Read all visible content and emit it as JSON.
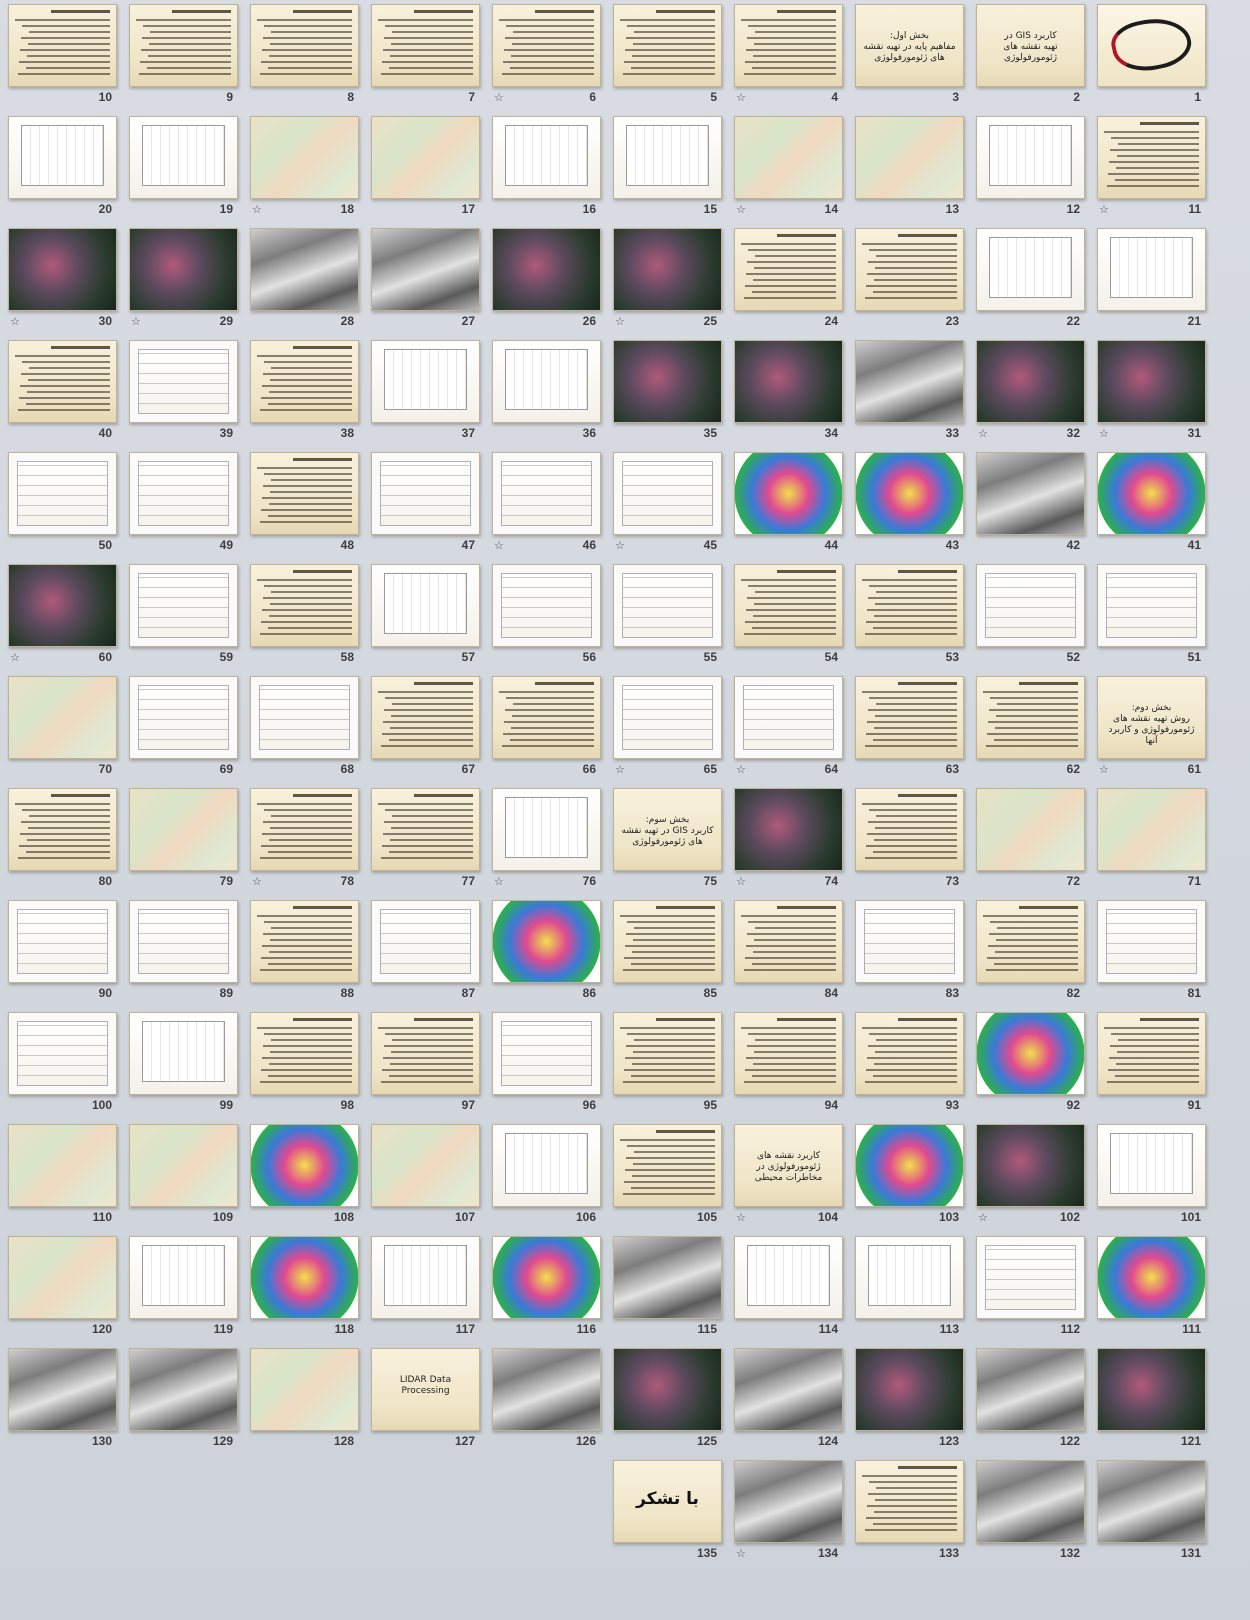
{
  "slides": [
    {
      "n": "1",
      "kind": "logo",
      "star": false
    },
    {
      "n": "2",
      "kind": "title",
      "text": "کاربرد GIS در\nتهیه نقشه های ژئومورفولوژی",
      "star": false
    },
    {
      "n": "3",
      "kind": "title",
      "text": "بخش اول:\nمفاهیم پایه در تهیه نقشه های ژئومورفولوژی",
      "star": false
    },
    {
      "n": "4",
      "kind": "text",
      "star": true
    },
    {
      "n": "5",
      "kind": "text",
      "star": false
    },
    {
      "n": "6",
      "kind": "text",
      "star": true
    },
    {
      "n": "7",
      "kind": "text",
      "star": false
    },
    {
      "n": "8",
      "kind": "text",
      "star": false
    },
    {
      "n": "9",
      "kind": "text",
      "star": false
    },
    {
      "n": "10",
      "kind": "text",
      "star": false
    },
    {
      "n": "11",
      "kind": "text",
      "star": true
    },
    {
      "n": "12",
      "kind": "figure",
      "star": false
    },
    {
      "n": "13",
      "kind": "map",
      "star": false
    },
    {
      "n": "14",
      "kind": "map",
      "star": true
    },
    {
      "n": "15",
      "kind": "figure",
      "star": false
    },
    {
      "n": "16",
      "kind": "figure",
      "star": false
    },
    {
      "n": "17",
      "kind": "map",
      "star": false
    },
    {
      "n": "18",
      "kind": "map",
      "star": true
    },
    {
      "n": "19",
      "kind": "figure",
      "star": false
    },
    {
      "n": "20",
      "kind": "figure",
      "star": false
    },
    {
      "n": "21",
      "kind": "figure",
      "star": false
    },
    {
      "n": "22",
      "kind": "figure",
      "star": false
    },
    {
      "n": "23",
      "kind": "text",
      "star": false
    },
    {
      "n": "24",
      "kind": "text",
      "star": false
    },
    {
      "n": "25",
      "kind": "sat",
      "star": true
    },
    {
      "n": "26",
      "kind": "sat",
      "star": false
    },
    {
      "n": "27",
      "kind": "gray",
      "star": false
    },
    {
      "n": "28",
      "kind": "gray",
      "star": false
    },
    {
      "n": "29",
      "kind": "sat",
      "star": true
    },
    {
      "n": "30",
      "kind": "sat",
      "star": true
    },
    {
      "n": "31",
      "kind": "sat",
      "star": true
    },
    {
      "n": "32",
      "kind": "sat",
      "star": true
    },
    {
      "n": "33",
      "kind": "gray",
      "star": false
    },
    {
      "n": "34",
      "kind": "sat",
      "star": false
    },
    {
      "n": "35",
      "kind": "sat",
      "star": false
    },
    {
      "n": "36",
      "kind": "figure",
      "star": false
    },
    {
      "n": "37",
      "kind": "figure",
      "star": false
    },
    {
      "n": "38",
      "kind": "text",
      "star": false
    },
    {
      "n": "39",
      "kind": "diagram",
      "star": false
    },
    {
      "n": "40",
      "kind": "text",
      "star": false
    },
    {
      "n": "41",
      "kind": "color",
      "star": false
    },
    {
      "n": "42",
      "kind": "gray",
      "star": false
    },
    {
      "n": "43",
      "kind": "color",
      "star": false
    },
    {
      "n": "44",
      "kind": "color",
      "star": false
    },
    {
      "n": "45",
      "kind": "diagram",
      "star": true
    },
    {
      "n": "46",
      "kind": "diagram",
      "star": true
    },
    {
      "n": "47",
      "kind": "diagram",
      "star": false
    },
    {
      "n": "48",
      "kind": "text",
      "star": false
    },
    {
      "n": "49",
      "kind": "diagram",
      "star": false
    },
    {
      "n": "50",
      "kind": "diagram",
      "star": false
    },
    {
      "n": "51",
      "kind": "diagram",
      "star": false
    },
    {
      "n": "52",
      "kind": "diagram",
      "star": false
    },
    {
      "n": "53",
      "kind": "text",
      "star": false
    },
    {
      "n": "54",
      "kind": "text",
      "star": false
    },
    {
      "n": "55",
      "kind": "diagram",
      "star": false
    },
    {
      "n": "56",
      "kind": "diagram",
      "star": false
    },
    {
      "n": "57",
      "kind": "figure",
      "star": false
    },
    {
      "n": "58",
      "kind": "text",
      "star": false
    },
    {
      "n": "59",
      "kind": "diagram",
      "star": false
    },
    {
      "n": "60",
      "kind": "sat",
      "star": true
    },
    {
      "n": "61",
      "kind": "title",
      "text": "بخش دوم:\nروش تهیه نقشه های ژئومورفولوژی و کاربرد آنها",
      "star": true
    },
    {
      "n": "62",
      "kind": "text",
      "star": false
    },
    {
      "n": "63",
      "kind": "text",
      "star": false
    },
    {
      "n": "64",
      "kind": "diagram",
      "star": true
    },
    {
      "n": "65",
      "kind": "diagram",
      "star": true
    },
    {
      "n": "66",
      "kind": "text",
      "star": false
    },
    {
      "n": "67",
      "kind": "text",
      "star": false
    },
    {
      "n": "68",
      "kind": "diagram",
      "star": false
    },
    {
      "n": "69",
      "kind": "diagram",
      "star": false
    },
    {
      "n": "70",
      "kind": "map",
      "star": false
    },
    {
      "n": "71",
      "kind": "map",
      "star": false
    },
    {
      "n": "72",
      "kind": "map",
      "star": false
    },
    {
      "n": "73",
      "kind": "text",
      "star": false
    },
    {
      "n": "74",
      "kind": "sat",
      "star": true
    },
    {
      "n": "75",
      "kind": "title",
      "text": "بخش سوم:\nکاربرد GIS در تهیه نقشه های ژئومورفولوژی",
      "star": false
    },
    {
      "n": "76",
      "kind": "figure",
      "star": true
    },
    {
      "n": "77",
      "kind": "text",
      "star": false
    },
    {
      "n": "78",
      "kind": "text",
      "star": true
    },
    {
      "n": "79",
      "kind": "map",
      "star": false
    },
    {
      "n": "80",
      "kind": "text",
      "star": false
    },
    {
      "n": "81",
      "kind": "diagram",
      "star": false
    },
    {
      "n": "82",
      "kind": "text",
      "star": false
    },
    {
      "n": "83",
      "kind": "diagram",
      "star": false
    },
    {
      "n": "84",
      "kind": "text",
      "star": false
    },
    {
      "n": "85",
      "kind": "text",
      "star": false
    },
    {
      "n": "86",
      "kind": "color",
      "star": false
    },
    {
      "n": "87",
      "kind": "diagram",
      "star": false
    },
    {
      "n": "88",
      "kind": "text",
      "star": false
    },
    {
      "n": "89",
      "kind": "diagram",
      "star": false
    },
    {
      "n": "90",
      "kind": "diagram",
      "star": false
    },
    {
      "n": "91",
      "kind": "text",
      "star": false
    },
    {
      "n": "92",
      "kind": "color",
      "star": false
    },
    {
      "n": "93",
      "kind": "text",
      "star": false
    },
    {
      "n": "94",
      "kind": "text",
      "star": false
    },
    {
      "n": "95",
      "kind": "text",
      "star": false
    },
    {
      "n": "96",
      "kind": "diagram",
      "star": false
    },
    {
      "n": "97",
      "kind": "text",
      "star": false
    },
    {
      "n": "98",
      "kind": "text",
      "star": false
    },
    {
      "n": "99",
      "kind": "figure",
      "star": false
    },
    {
      "n": "100",
      "kind": "diagram",
      "star": false
    },
    {
      "n": "101",
      "kind": "figure",
      "star": false
    },
    {
      "n": "102",
      "kind": "sat",
      "star": true
    },
    {
      "n": "103",
      "kind": "color",
      "star": false
    },
    {
      "n": "104",
      "kind": "title",
      "text": "کاربرد نقشه های ژئومورفولوژی در مخاطرات محیطی",
      "star": true
    },
    {
      "n": "105",
      "kind": "text",
      "star": false
    },
    {
      "n": "106",
      "kind": "figure",
      "star": false
    },
    {
      "n": "107",
      "kind": "map",
      "star": false
    },
    {
      "n": "108",
      "kind": "color",
      "star": false
    },
    {
      "n": "109",
      "kind": "map",
      "star": false
    },
    {
      "n": "110",
      "kind": "map",
      "star": false
    },
    {
      "n": "111",
      "kind": "color",
      "star": false
    },
    {
      "n": "112",
      "kind": "diagram",
      "star": false
    },
    {
      "n": "113",
      "kind": "figure",
      "star": false
    },
    {
      "n": "114",
      "kind": "figure",
      "star": false
    },
    {
      "n": "115",
      "kind": "gray",
      "star": false
    },
    {
      "n": "116",
      "kind": "color",
      "star": false
    },
    {
      "n": "117",
      "kind": "figure",
      "star": false
    },
    {
      "n": "118",
      "kind": "color",
      "star": false
    },
    {
      "n": "119",
      "kind": "figure",
      "star": false
    },
    {
      "n": "120",
      "kind": "map",
      "star": false
    },
    {
      "n": "121",
      "kind": "sat",
      "star": false
    },
    {
      "n": "122",
      "kind": "gray",
      "star": false
    },
    {
      "n": "123",
      "kind": "sat",
      "star": false
    },
    {
      "n": "124",
      "kind": "gray",
      "star": false
    },
    {
      "n": "125",
      "kind": "sat",
      "star": false
    },
    {
      "n": "126",
      "kind": "gray",
      "star": false
    },
    {
      "n": "127",
      "kind": "title",
      "text": "LIDAR Data Processing",
      "star": false
    },
    {
      "n": "128",
      "kind": "map",
      "star": false
    },
    {
      "n": "129",
      "kind": "gray",
      "star": false
    },
    {
      "n": "130",
      "kind": "gray",
      "star": false
    },
    {
      "n": "131",
      "kind": "gray",
      "star": false
    },
    {
      "n": "132",
      "kind": "gray",
      "star": false
    },
    {
      "n": "133",
      "kind": "text",
      "star": false
    },
    {
      "n": "134",
      "kind": "gray",
      "star": true
    },
    {
      "n": "135",
      "kind": "end",
      "text": "با تشکر",
      "star": false
    }
  ],
  "star_symbol": "☆",
  "colors": {
    "slide_bg": "#efe5c8",
    "page_bg": "#cdd2d9",
    "number": "#3d3d3d"
  }
}
